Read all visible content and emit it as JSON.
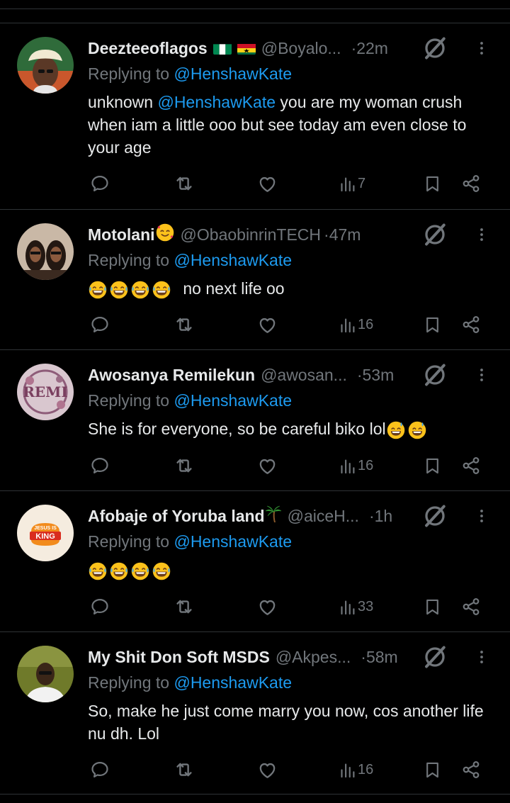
{
  "tweets": [
    {
      "name": "Deezteeoflagos",
      "handle": "@Boyalo...",
      "time": "·22m",
      "replying_prefix": "Replying to ",
      "replying_to": "@HenshawKate",
      "text_before": "unknown ",
      "text_mention": "@HenshawKate",
      "text_after": " you are my woman crush when iam a little ooo but see today am even close to your age",
      "views": "7"
    },
    {
      "name": "Motolani",
      "handle": "@ObaobinrinTECH",
      "time": "·47m",
      "replying_prefix": "Replying to ",
      "replying_to": "@HenshawKate",
      "text": "no next life oo",
      "views": "16"
    },
    {
      "name": "Awosanya Remilekun",
      "handle": "@awosan...",
      "time": "·53m",
      "replying_prefix": "Replying to ",
      "replying_to": "@HenshawKate",
      "text": "She is for everyone, so be careful biko lol",
      "avatar_text": "REMI",
      "views": "16"
    },
    {
      "name": "Afobaje of Yoruba land",
      "handle": "@aiceH...",
      "time": "·1h",
      "replying_prefix": "Replying to ",
      "replying_to": "@HenshawKate",
      "avatar_text_top": "JESUS IS",
      "avatar_text_main": "KING",
      "views": "33"
    },
    {
      "name": "My Shit Don Soft MSDS",
      "handle": "@Akpes...",
      "time": "·58m",
      "replying_prefix": "Replying to ",
      "replying_to": "@HenshawKate",
      "text": "So, make he just come marry you now, cos another life nu dh. Lol",
      "views": "16"
    }
  ],
  "colors": {
    "background": "#000000",
    "text": "#e7e9ea",
    "muted": "#71767b",
    "link": "#1d9bf0",
    "divider": "#2f3336"
  },
  "icons": [
    "reply-icon",
    "retweet-icon",
    "like-icon",
    "views-icon",
    "bookmark-icon",
    "share-icon",
    "grok-icon",
    "more-icon"
  ]
}
